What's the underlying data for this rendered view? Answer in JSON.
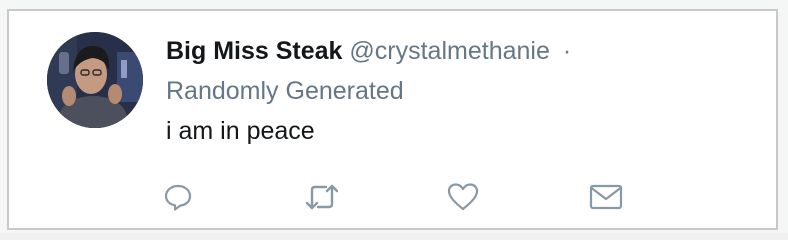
{
  "tweet": {
    "display_name": "Big Miss Steak",
    "handle": "@crystalmethanie",
    "separator": "·",
    "source": "Randomly Generated",
    "text": "i am in peace"
  },
  "actions": {
    "reply_icon": "reply-icon",
    "retweet_icon": "retweet-icon",
    "like_icon": "heart-icon",
    "dm_icon": "envelope-icon"
  },
  "colors": {
    "name": "#14171a",
    "secondary": "#657786",
    "icon": "#8899a6",
    "border": "#c9c9c9"
  }
}
